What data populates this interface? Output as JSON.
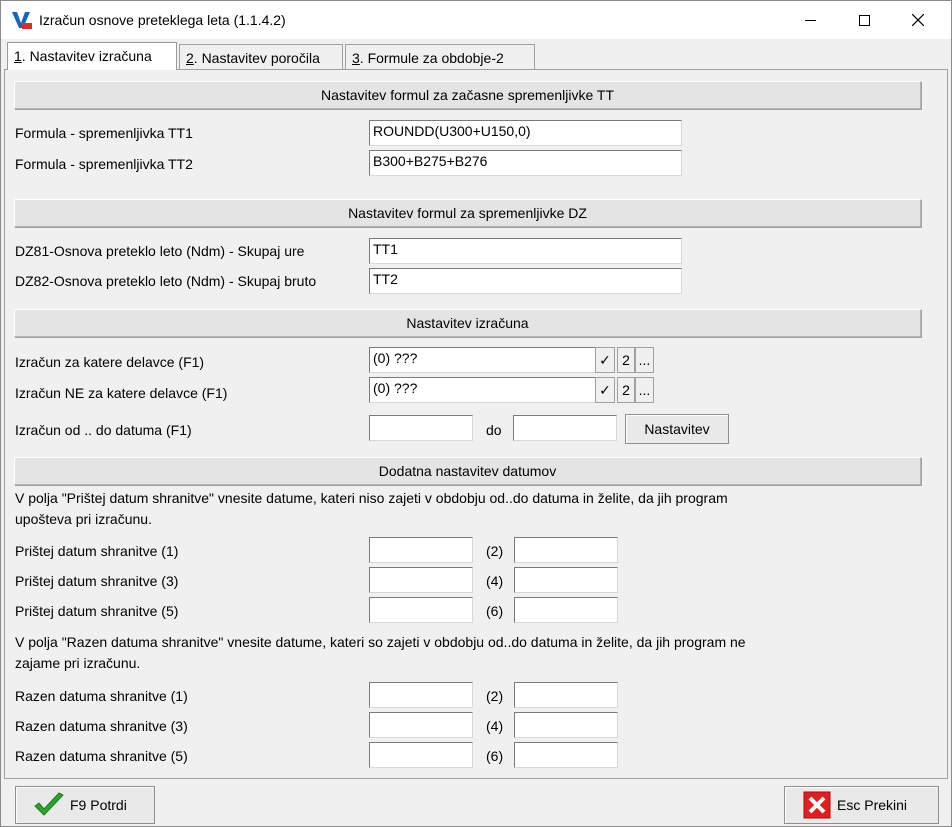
{
  "window": {
    "title": "Izračun osnove preteklega leta  (1.1.4.2)"
  },
  "tabs": [
    {
      "hotkey": "1",
      "label": ". Nastavitev izračuna"
    },
    {
      "hotkey": "2",
      "label": ". Nastavitev poročila"
    },
    {
      "hotkey": "3",
      "label": ". Formule za obdobje-2"
    }
  ],
  "section_tt": {
    "title": "Nastavitev formul za začasne spremenljivke TT",
    "rows": [
      {
        "label": "Formula - spremenljivka TT1",
        "value": "ROUNDD(U300+U150,0)"
      },
      {
        "label": "Formula - spremenljivka TT2",
        "value": "B300+B275+B276"
      }
    ]
  },
  "section_dz": {
    "title": "Nastavitev formul za spremenljivke DZ",
    "rows": [
      {
        "label": "DZ81-Osnova preteklo leto (Ndm) - Skupaj ure",
        "value": "TT1"
      },
      {
        "label": "DZ82-Osnova preteklo leto (Ndm) - Skupaj bruto",
        "value": "TT2"
      }
    ]
  },
  "section_calc": {
    "title": "Nastavitev izračuna",
    "rows": [
      {
        "label": "Izračun za katere delavce (F1)",
        "value": "(0) ???",
        "check": "✓",
        "num": "2",
        "dots": "..."
      },
      {
        "label": "Izračun NE za katere delavce (F1)",
        "value": "(0) ???",
        "check": "✓",
        "num": "2",
        "dots": "..."
      }
    ],
    "range_label": "Izračun od .. do datuma (F1)",
    "range_from": "",
    "range_to_label": "do",
    "range_to": "",
    "settings_button": "Nastavitev"
  },
  "section_dates": {
    "title": "Dodatna nastavitev datumov",
    "note1": "V polja \"Prištej datum shranitve\" vnesite datume, kateri niso zajeti v obdobju od..do datuma in želite, da jih program upošteva pri izračunu.",
    "add_rows": [
      {
        "label": "Prištej datum shranitve (1)",
        "value1": "",
        "pair": "(2)",
        "value2": ""
      },
      {
        "label": "Prištej datum shranitve (3)",
        "value1": "",
        "pair": "(4)",
        "value2": ""
      },
      {
        "label": "Prištej datum shranitve (5)",
        "value1": "",
        "pair": "(6)",
        "value2": ""
      }
    ],
    "note2": "V polja \"Razen datuma shranitve\" vnesite datume, kateri so zajeti v obdobju od..do datuma in želite, da jih program ne zajame pri izračunu.",
    "except_rows": [
      {
        "label": "Razen datuma shranitve (1)",
        "value1": "",
        "pair": "(2)",
        "value2": ""
      },
      {
        "label": "Razen datuma shranitve (3)",
        "value1": "",
        "pair": "(4)",
        "value2": ""
      },
      {
        "label": "Razen datuma shranitve (5)",
        "value1": "",
        "pair": "(6)",
        "value2": ""
      }
    ]
  },
  "footer": {
    "confirm_label": "F9 Potrdi",
    "cancel_label": "Esc Prekini"
  },
  "colors": {
    "confirm_icon": "#2fa32f",
    "cancel_icon": "#e02020"
  }
}
